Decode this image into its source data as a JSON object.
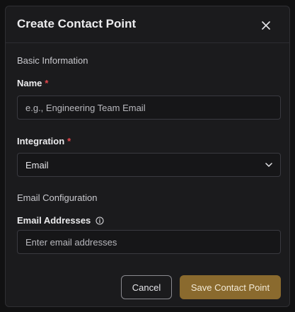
{
  "dialog": {
    "title": "Create Contact Point",
    "close_icon": "close-icon"
  },
  "sections": {
    "basic": "Basic Information",
    "email_config": "Email Configuration"
  },
  "fields": {
    "name": {
      "label": "Name",
      "required_mark": "*",
      "placeholder": "e.g., Engineering Team Email",
      "value": ""
    },
    "integration": {
      "label": "Integration",
      "required_mark": "*",
      "selected": "Email",
      "icon": "chevron-down-icon"
    },
    "email_addresses": {
      "label": "Email Addresses",
      "info_icon": "info-icon",
      "placeholder": "Enter email addresses",
      "value": ""
    }
  },
  "actions": {
    "cancel": "Cancel",
    "save": "Save Contact Point"
  },
  "colors": {
    "background": "#111112",
    "dialog": "#1b1b1d",
    "required": "#e5484d",
    "primary_button": "#8a6a2e"
  }
}
